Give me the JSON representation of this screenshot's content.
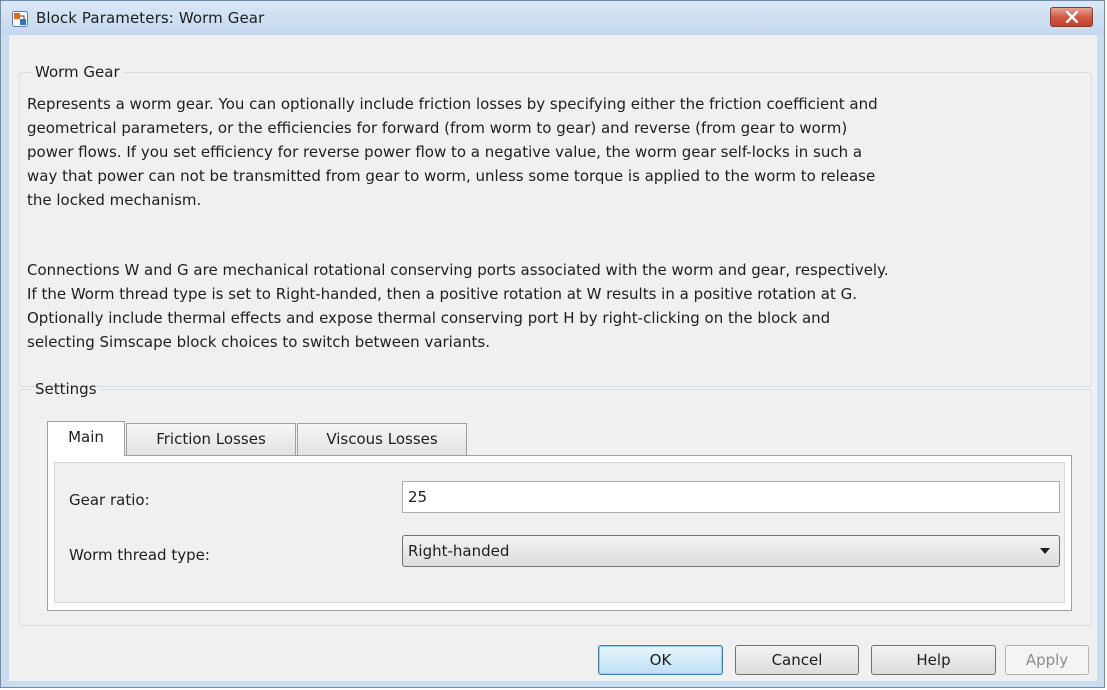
{
  "window": {
    "title": "Block Parameters: Worm Gear"
  },
  "description_group": {
    "legend": "Worm Gear",
    "paragraph1_lines": [
      "Represents a worm gear. You can optionally include friction losses by specifying either the friction coefficient and",
      "geometrical parameters, or the efficiencies for forward (from worm to gear) and reverse (from gear to worm)",
      "power flows. If you set efficiency for reverse power flow to a negative value, the worm gear self-locks in such a",
      "way that power can not be transmitted from gear to worm, unless some torque is applied to the worm to release",
      "the locked mechanism."
    ],
    "paragraph2_lines": [
      "Connections W and G are mechanical rotational conserving ports associated with the worm and gear, respectively.",
      "If the Worm thread type is set to Right-handed, then a positive rotation at W results in a positive rotation at G.",
      "Optionally include thermal effects and expose thermal conserving port H by right-clicking on the block and",
      "selecting Simscape block choices to switch between variants."
    ]
  },
  "settings": {
    "legend": "Settings",
    "tabs": [
      {
        "label": "Main",
        "active": true
      },
      {
        "label": "Friction Losses",
        "active": false
      },
      {
        "label": "Viscous Losses",
        "active": false
      }
    ],
    "fields": {
      "gear_ratio": {
        "label": "Gear ratio:",
        "value": "25"
      },
      "worm_thread_type": {
        "label": "Worm thread type:",
        "value": "Right-handed"
      }
    }
  },
  "buttons": {
    "ok": "OK",
    "cancel": "Cancel",
    "help": "Help",
    "apply": "Apply"
  },
  "icons": {
    "app": "simulink-block-icon",
    "close": "close-icon",
    "dropdown": "chevron-down-icon"
  },
  "colors": {
    "close_button": "#c9412c",
    "ok_border": "#3c7fb1",
    "frame": "#c9dcf0"
  }
}
